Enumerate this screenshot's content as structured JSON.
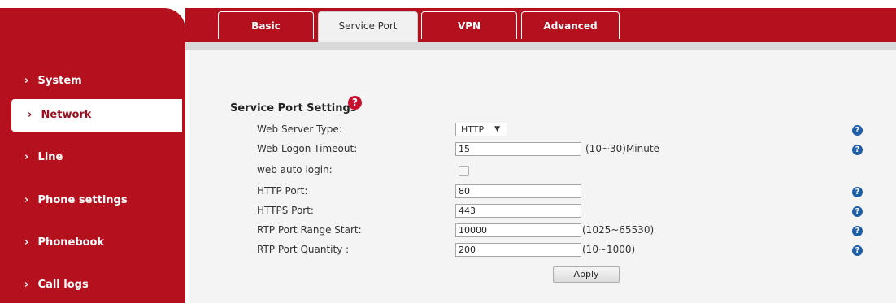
{
  "tabs": {
    "basic": "Basic",
    "service_port": "Service Port",
    "vpn": "VPN",
    "advanced": "Advanced"
  },
  "sidebar": {
    "items": [
      {
        "label": "System"
      },
      {
        "label": "Network",
        "active": true
      },
      {
        "label": "Line"
      },
      {
        "label": "Phone settings"
      },
      {
        "label": "Phonebook"
      },
      {
        "label": "Call logs"
      }
    ],
    "chevron": "›"
  },
  "section": {
    "title": "Service Port Settings",
    "help_glyph": "?"
  },
  "form": {
    "web_server_type": {
      "label": "Web Server Type:",
      "value": "HTTP",
      "arrow": "▼"
    },
    "web_logon_timeout": {
      "label": "Web Logon Timeout:",
      "value": "15",
      "hint": "(10~30)Minute"
    },
    "web_auto_login": {
      "label": "web auto login:",
      "checked": false
    },
    "http_port": {
      "label": "HTTP Port:",
      "value": "80"
    },
    "https_port": {
      "label": "HTTPS Port:",
      "value": "443"
    },
    "rtp_port_start": {
      "label": "RTP Port Range Start:",
      "value": "10000",
      "hint": "(1025~65530)"
    },
    "rtp_port_quantity": {
      "label": "RTP Port Quantity :",
      "value": "200",
      "hint": "(10~1000)"
    }
  },
  "help_icon_glyph": "?",
  "apply_label": "Apply",
  "colors": {
    "brand_red": "#b5101e",
    "help_blue": "#1f5fa8",
    "section_help_red": "#c8102e"
  }
}
